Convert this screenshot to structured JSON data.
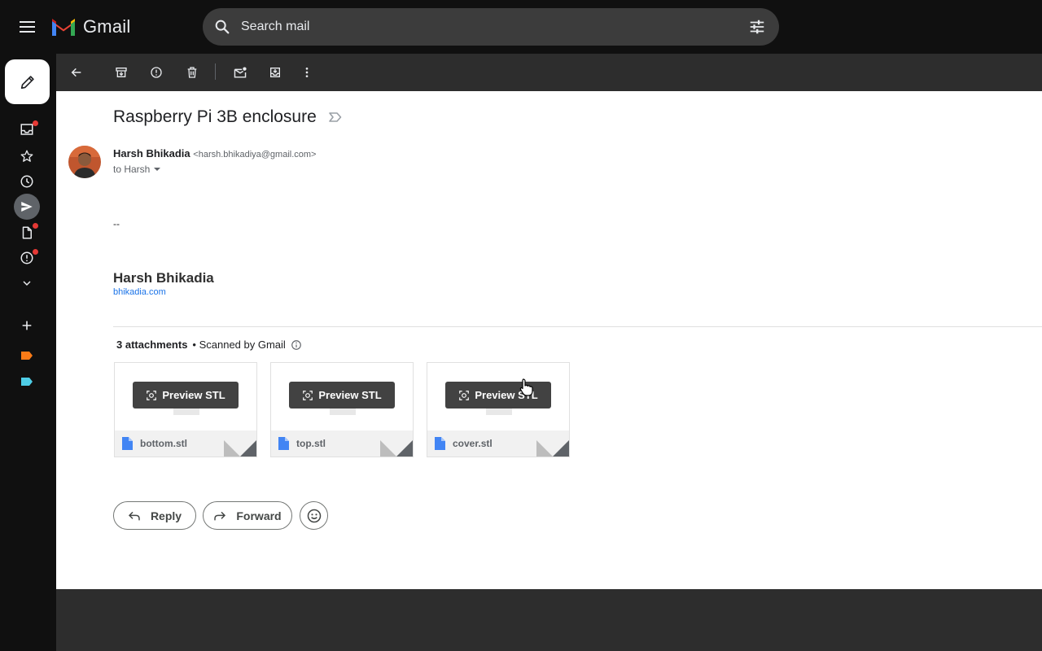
{
  "header": {
    "app_name": "Gmail",
    "search_placeholder": "Search mail"
  },
  "colors": {
    "gmail_red": "#EA4335",
    "gmail_blue": "#4285F4",
    "gmail_green": "#34A853",
    "gmail_yellow": "#FBBC04",
    "label_orange": "#FA7B17",
    "label_blue": "#4ECDE6",
    "link": "#1a73e8"
  },
  "sidebar": {
    "items": [
      {
        "icon": "inbox-icon",
        "badge": true
      },
      {
        "icon": "star-icon",
        "badge": false
      },
      {
        "icon": "clock-icon",
        "badge": false
      },
      {
        "icon": "send-icon",
        "badge": false,
        "active": true
      },
      {
        "icon": "draft-icon",
        "badge": true
      },
      {
        "icon": "spam-icon",
        "badge": true
      },
      {
        "icon": "chevron-down-icon",
        "badge": false
      }
    ]
  },
  "toolbar": {
    "icons": [
      "back-arrow-icon",
      "archive-icon",
      "report-spam-icon",
      "delete-icon",
      "mark-unread-icon",
      "move-to-icon",
      "more-vert-icon"
    ]
  },
  "message": {
    "subject": "Raspberry Pi 3B enclosure",
    "sender_name": "Harsh Bhikadia",
    "sender_email": "<harsh.bhikadiya@gmail.com>",
    "to_line": "to Harsh",
    "signature_dash": "--",
    "signature_name": "Harsh Bhikadia",
    "signature_link": "bhikadia.com"
  },
  "attachments": {
    "count_label": "3 attachments",
    "scanned_label": "• Scanned by Gmail",
    "preview_label": "Preview STL",
    "files": [
      {
        "name": "bottom.stl"
      },
      {
        "name": "top.stl"
      },
      {
        "name": "cover.stl"
      }
    ]
  },
  "actions": {
    "reply_label": "Reply",
    "forward_label": "Forward"
  }
}
